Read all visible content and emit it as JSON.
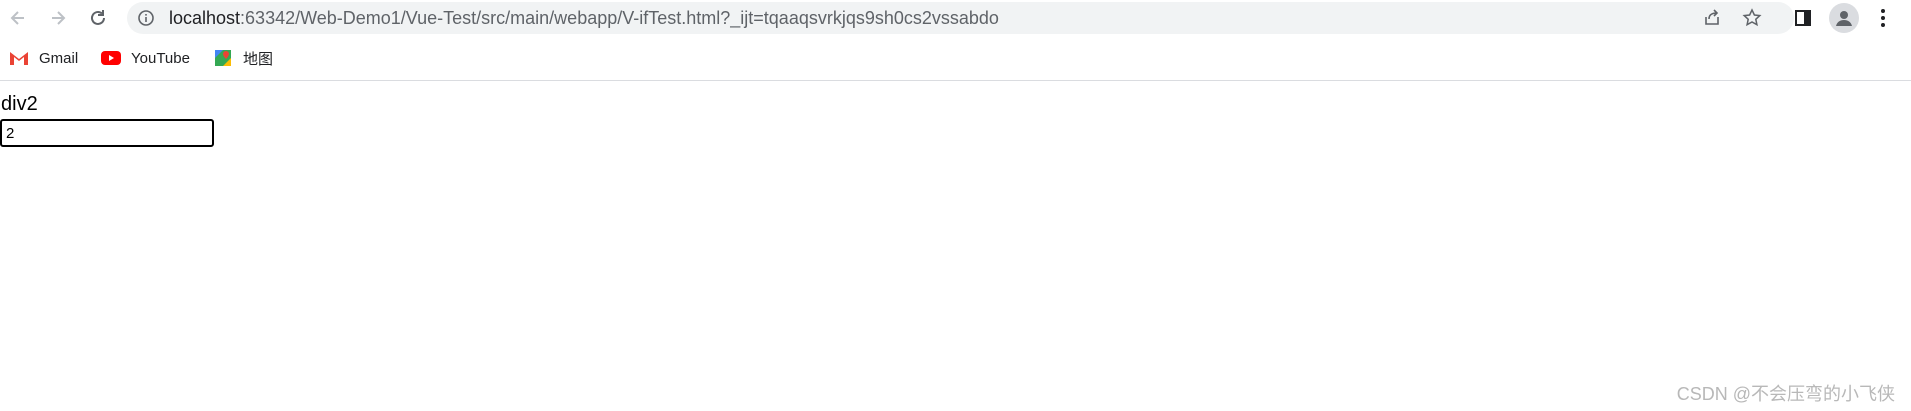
{
  "browser": {
    "url_host": "localhost",
    "url_rest": ":63342/Web-Demo1/Vue-Test/src/main/webapp/V-ifTest.html?_ijt=tqaaqsvrkjqs9sh0cs2vssabdo",
    "icons": {
      "back": "arrow-left-icon",
      "forward": "arrow-right-icon",
      "reload": "reload-icon",
      "site_info": "info-icon",
      "share": "share-icon",
      "bookmark": "star-icon",
      "side_panel": "side-panel-icon",
      "profile": "person-icon",
      "menu": "kebab-menu-icon"
    }
  },
  "bookmarks": [
    {
      "label": "Gmail",
      "icon": "gmail-icon"
    },
    {
      "label": "YouTube",
      "icon": "youtube-icon"
    },
    {
      "label": "地图",
      "icon": "maps-icon"
    }
  ],
  "page": {
    "text": "div2",
    "input_value": "2"
  },
  "watermark": "CSDN @不会压弯的小飞侠"
}
